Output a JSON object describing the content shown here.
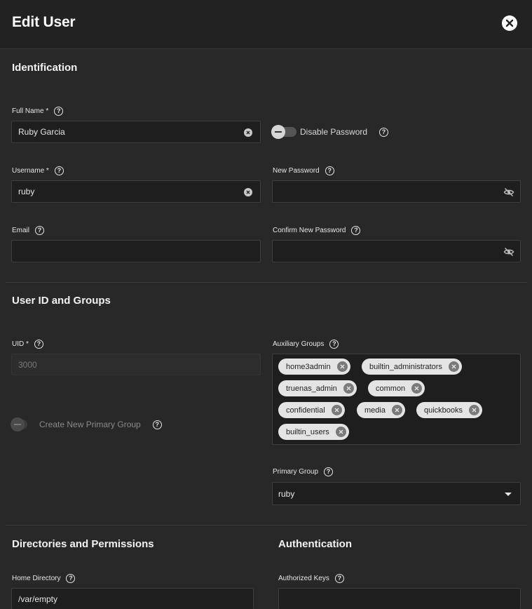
{
  "header": {
    "title": "Edit User"
  },
  "sections": {
    "identification": "Identification",
    "user_id_groups": "User ID and Groups",
    "directories": "Directories and Permissions",
    "authentication": "Authentication"
  },
  "identification": {
    "full_name_label": "Full Name *",
    "full_name_value": "Ruby Garcia",
    "username_label": "Username *",
    "username_value": "ruby",
    "email_label": "Email",
    "email_value": "",
    "disable_password_label": "Disable Password",
    "new_password_label": "New Password",
    "confirm_password_label": "Confirm New Password"
  },
  "user_id": {
    "uid_label": "UID *",
    "uid_value": "3000",
    "create_group_label": "Create New Primary Group",
    "aux_groups_label": "Auxiliary Groups",
    "aux_groups": [
      "home3admin",
      "builtin_administrators",
      "truenas_admin",
      "common",
      "confidential",
      "media",
      "quickbooks",
      "builtin_users"
    ],
    "primary_group_label": "Primary Group",
    "primary_group_value": "ruby"
  },
  "directories": {
    "home_label": "Home Directory",
    "home_value": "/var/empty"
  },
  "authentication": {
    "keys_label": "Authorized Keys"
  },
  "icons": {
    "close": "close-icon",
    "help": "help-icon",
    "clear": "clear-icon",
    "eye": "eye-off-icon",
    "chip_remove": "chip-remove-icon",
    "dropdown": "chevron-down-icon"
  }
}
